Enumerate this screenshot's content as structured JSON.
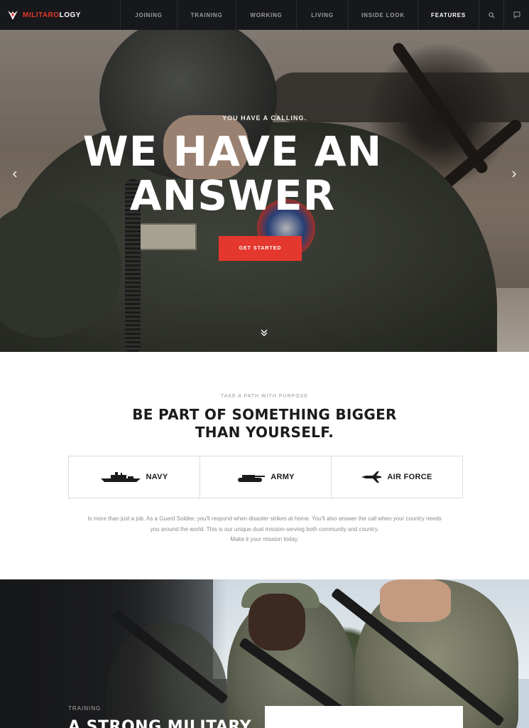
{
  "brand": {
    "name_accent": "MILITARO",
    "name_rest": "LOGY",
    "accent_color": "#e4372d"
  },
  "nav": {
    "items": [
      {
        "label": "JOINING",
        "active": false
      },
      {
        "label": "TRAINING",
        "active": false
      },
      {
        "label": "WORKING",
        "active": false
      },
      {
        "label": "LIVING",
        "active": false
      },
      {
        "label": "INSIDE LOOK",
        "active": false
      },
      {
        "label": "FEATURES",
        "active": true
      }
    ],
    "icons": [
      "search-icon",
      "chat-icon"
    ]
  },
  "hero": {
    "subtitle": "YOU HAVE A CALLING.",
    "title_line1": "WE HAVE AN",
    "title_line2": "ANSWER",
    "cta_label": "GET STARTED",
    "cta_color": "#e4372d"
  },
  "path": {
    "subtitle": "TAKE A PATH WITH PURPOSE",
    "title_line1": "BE PART OF SOMETHING BIGGER",
    "title_line2": "THAN YOURSELF.",
    "branches": [
      {
        "label": "NAVY",
        "icon": "ship-icon"
      },
      {
        "label": "ARMY",
        "icon": "tank-icon"
      },
      {
        "label": "AIR FORCE",
        "icon": "jet-icon"
      }
    ],
    "text_line1": "Is more than just a job. As a Guard Soldier, you'll respond when disaster strikes at home. You'll also answer the call when your country needs",
    "text_line2": "you around the world. This is our unique dual mission-serving both community and country.",
    "text_line3": "Make it your mission today."
  },
  "training": {
    "subtitle": "TRAINING",
    "title": "A STRONG MILITARY"
  }
}
